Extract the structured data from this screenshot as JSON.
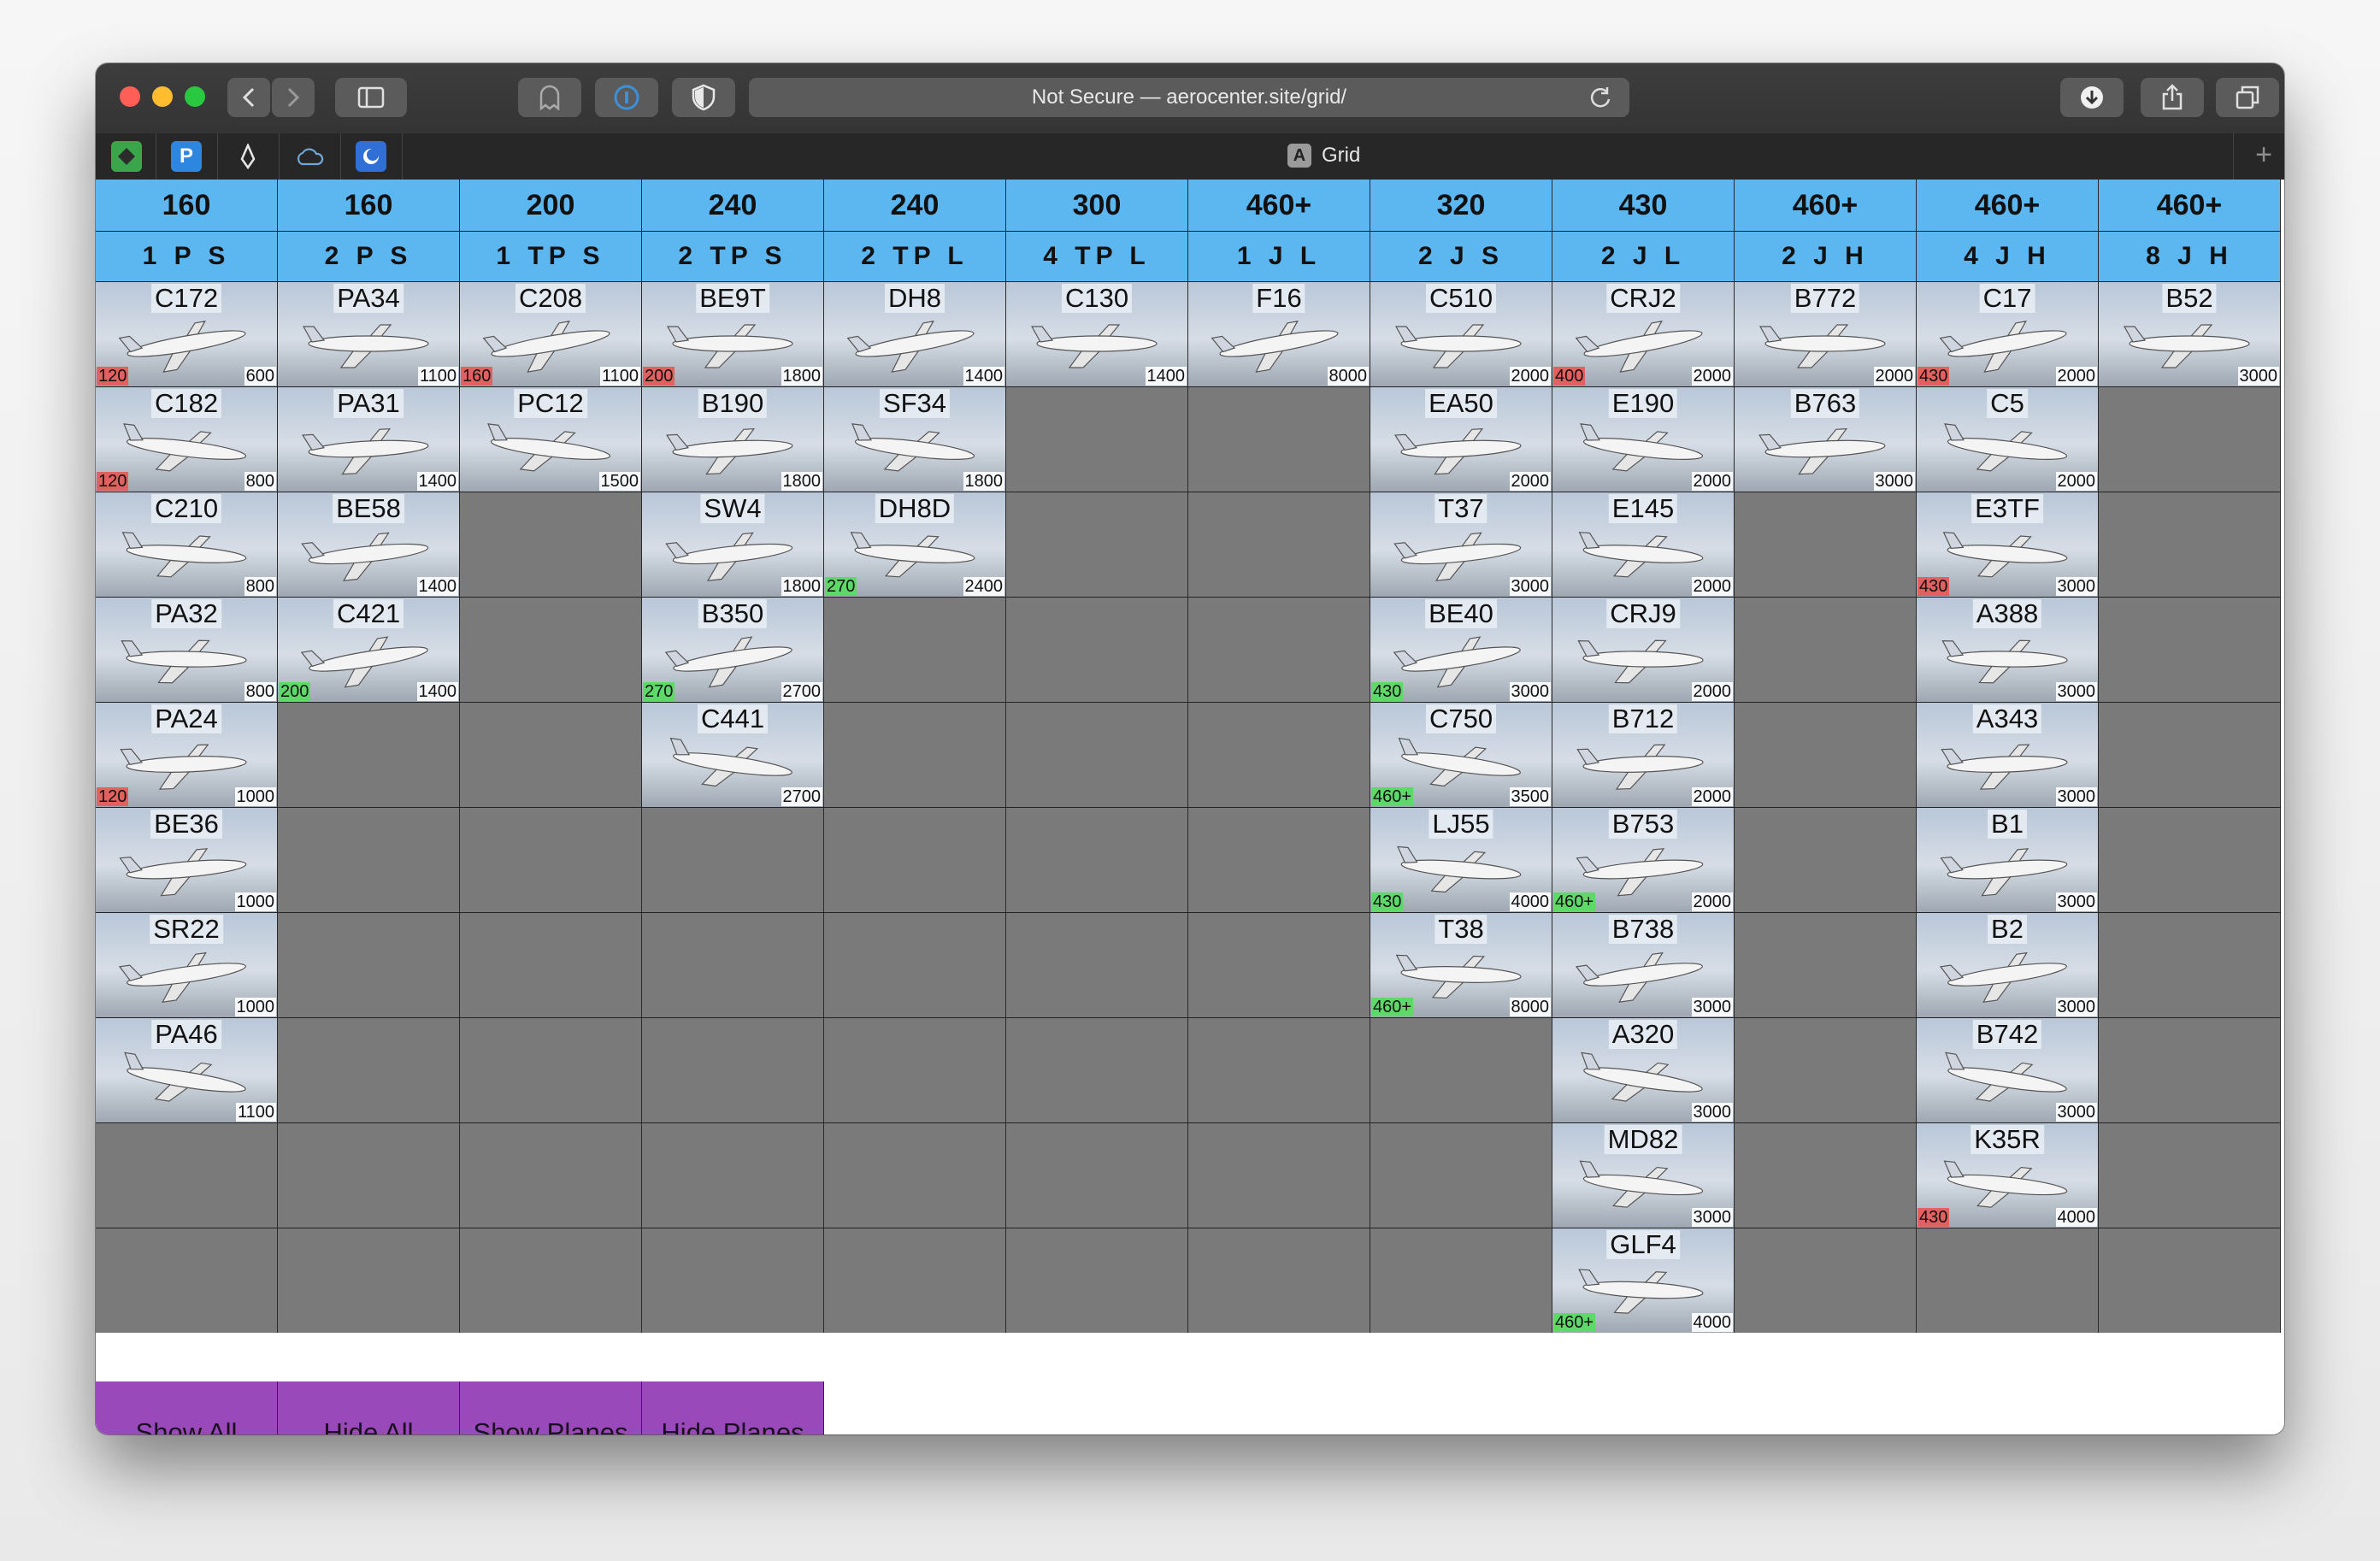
{
  "browser": {
    "address": "Not Secure — aerocenter.site/grid/",
    "tab_title": "Grid",
    "tab_icon_letter": "A"
  },
  "columns": [
    {
      "speed": "160",
      "cls": "1 P S"
    },
    {
      "speed": "160",
      "cls": "2 P S"
    },
    {
      "speed": "200",
      "cls": "1 TP S"
    },
    {
      "speed": "240",
      "cls": "2 TP S"
    },
    {
      "speed": "240",
      "cls": "2 TP L"
    },
    {
      "speed": "300",
      "cls": "4 TP L"
    },
    {
      "speed": "460+",
      "cls": "1 J L"
    },
    {
      "speed": "320",
      "cls": "2 J S"
    },
    {
      "speed": "430",
      "cls": "2 J L"
    },
    {
      "speed": "460+",
      "cls": "2 J H"
    },
    {
      "speed": "460+",
      "cls": "4 J H"
    },
    {
      "speed": "460+",
      "cls": "8 J H"
    }
  ],
  "grid": [
    [
      {
        "name": "C172",
        "alt": "600",
        "spd": "120",
        "spd_color": "red"
      },
      {
        "name": "C182",
        "alt": "800",
        "spd": "120",
        "spd_color": "red"
      },
      {
        "name": "C210",
        "alt": "800"
      },
      {
        "name": "PA32",
        "alt": "800"
      },
      {
        "name": "PA24",
        "alt": "1000",
        "spd": "120",
        "spd_color": "red"
      },
      {
        "name": "BE36",
        "alt": "1000"
      },
      {
        "name": "SR22",
        "alt": "1000"
      },
      {
        "name": "PA46",
        "alt": "1100"
      }
    ],
    [
      {
        "name": "PA34",
        "alt": "1100"
      },
      {
        "name": "PA31",
        "alt": "1400"
      },
      {
        "name": "BE58",
        "alt": "1400"
      },
      {
        "name": "C421",
        "alt": "1400",
        "spd": "200",
        "spd_color": "green"
      }
    ],
    [
      {
        "name": "C208",
        "alt": "1100",
        "spd": "160",
        "spd_color": "red"
      },
      {
        "name": "PC12",
        "alt": "1500"
      }
    ],
    [
      {
        "name": "BE9T",
        "alt": "1800",
        "spd": "200",
        "spd_color": "red"
      },
      {
        "name": "B190",
        "alt": "1800"
      },
      {
        "name": "SW4",
        "alt": "1800"
      },
      {
        "name": "B350",
        "alt": "2700",
        "spd": "270",
        "spd_color": "green"
      },
      {
        "name": "C441",
        "alt": "2700"
      }
    ],
    [
      {
        "name": "DH8",
        "alt": "1400"
      },
      {
        "name": "SF34",
        "alt": "1800"
      },
      {
        "name": "DH8D",
        "alt": "2400",
        "spd": "270",
        "spd_color": "green"
      }
    ],
    [
      {
        "name": "C130",
        "alt": "1400"
      }
    ],
    [
      {
        "name": "F16",
        "alt": "8000"
      }
    ],
    [
      {
        "name": "C510",
        "alt": "2000"
      },
      {
        "name": "EA50",
        "alt": "2000"
      },
      {
        "name": "T37",
        "alt": "3000"
      },
      {
        "name": "BE40",
        "alt": "3000",
        "spd": "430",
        "spd_color": "green"
      },
      {
        "name": "C750",
        "alt": "3500",
        "spd": "460+",
        "spd_color": "green"
      },
      {
        "name": "LJ55",
        "alt": "4000",
        "spd": "430",
        "spd_color": "green"
      },
      {
        "name": "T38",
        "alt": "8000",
        "spd": "460+",
        "spd_color": "green"
      }
    ],
    [
      {
        "name": "CRJ2",
        "alt": "2000",
        "spd": "400",
        "spd_color": "red"
      },
      {
        "name": "E190",
        "alt": "2000"
      },
      {
        "name": "E145",
        "alt": "2000"
      },
      {
        "name": "CRJ9",
        "alt": "2000"
      },
      {
        "name": "B712",
        "alt": "2000"
      },
      {
        "name": "B753",
        "alt": "2000",
        "spd": "460+",
        "spd_color": "green"
      },
      {
        "name": "B738",
        "alt": "3000"
      },
      {
        "name": "A320",
        "alt": "3000"
      },
      {
        "name": "MD82",
        "alt": "3000"
      },
      {
        "name": "GLF4",
        "alt": "4000",
        "spd": "460+",
        "spd_color": "green"
      }
    ],
    [
      {
        "name": "B772",
        "alt": "2000"
      },
      {
        "name": "B763",
        "alt": "3000"
      }
    ],
    [
      {
        "name": "C17",
        "alt": "2000",
        "spd": "430",
        "spd_color": "red"
      },
      {
        "name": "C5",
        "alt": "2000"
      },
      {
        "name": "E3TF",
        "alt": "3000",
        "spd": "430",
        "spd_color": "red"
      },
      {
        "name": "A388",
        "alt": "3000"
      },
      {
        "name": "A343",
        "alt": "3000"
      },
      {
        "name": "B1",
        "alt": "3000"
      },
      {
        "name": "B2",
        "alt": "3000"
      },
      {
        "name": "B742",
        "alt": "3000"
      },
      {
        "name": "K35R",
        "alt": "4000",
        "spd": "430",
        "spd_color": "red"
      }
    ],
    [
      {
        "name": "B52",
        "alt": "3000"
      }
    ]
  ],
  "buttons": [
    "Show All",
    "Hide All",
    "Show Planes",
    "Hide Planes"
  ],
  "colors": {
    "header_bg": "#5cb6f0",
    "empty_cell": "#7a7a7a",
    "button_bg": "#9a49bb",
    "speed_red": "#e0615f",
    "speed_green": "#5fd86a"
  }
}
